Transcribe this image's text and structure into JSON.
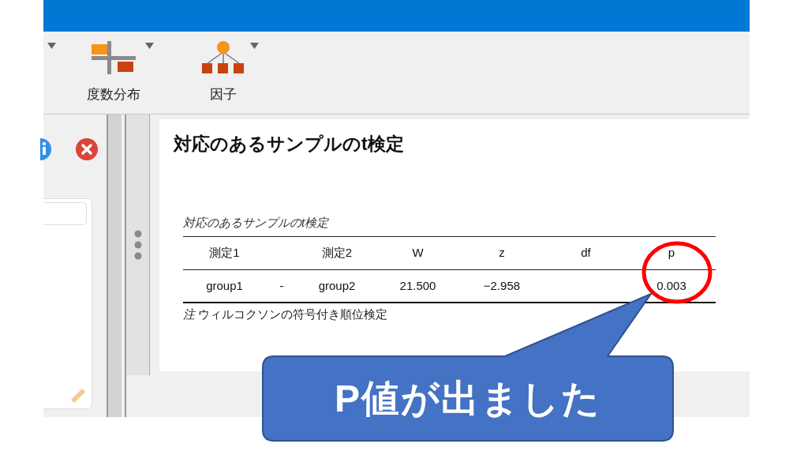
{
  "toolbar": {
    "buttons": [
      {
        "label": "度数分布",
        "has_menu": true,
        "kind": "frequencies"
      },
      {
        "label": "因子",
        "has_menu": true,
        "kind": "factor"
      }
    ]
  },
  "results": {
    "title": "対応のあるサンプルのt検定",
    "table": {
      "caption": "対応のあるサンプルのt検定",
      "columns": [
        "測定1",
        "測定2",
        "W",
        "z",
        "df",
        "p"
      ],
      "rows": [
        {
          "measure_1": "group1",
          "separator": "-",
          "measure_2": "group2",
          "W": "21.500",
          "z": "−2.958",
          "p": "0.003"
        }
      ],
      "note": "*注* ウィルコクソンの符号付き順位検定"
    }
  },
  "callout": {
    "text": "P値が出ました"
  }
}
